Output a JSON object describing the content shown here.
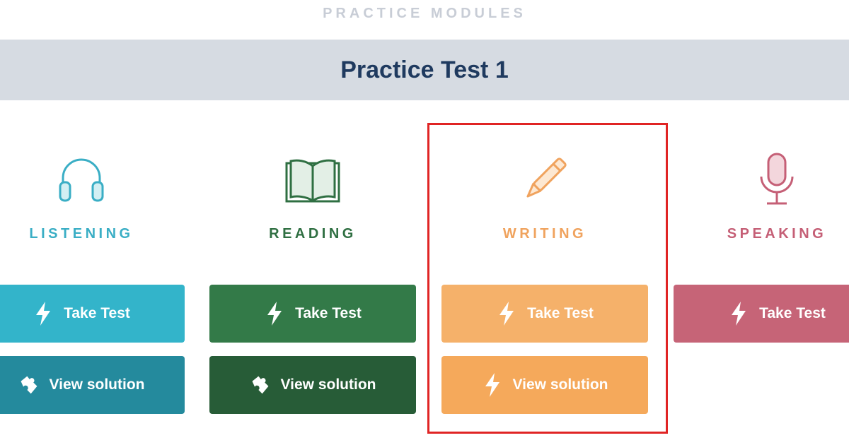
{
  "header": {
    "section_label": "PRACTICE MODULES",
    "title": "Practice Test 1"
  },
  "modules": [
    {
      "name": "LISTENING",
      "icon": "headphones-icon",
      "color": "#3aaec5",
      "take_label": "Take Test",
      "solution_label": "View solution"
    },
    {
      "name": "READING",
      "icon": "open-book-icon",
      "color": "#2f6f42",
      "take_label": "Take Test",
      "solution_label": "View solution"
    },
    {
      "name": "WRITING",
      "icon": "pencil-icon",
      "color": "#f0a35e",
      "take_label": "Take Test",
      "solution_label": "View solution",
      "highlighted": true
    },
    {
      "name": "SPEAKING",
      "icon": "microphone-icon",
      "color": "#c55f76",
      "take_label": "Take Test"
    }
  ],
  "highlight_color": "#e02424"
}
